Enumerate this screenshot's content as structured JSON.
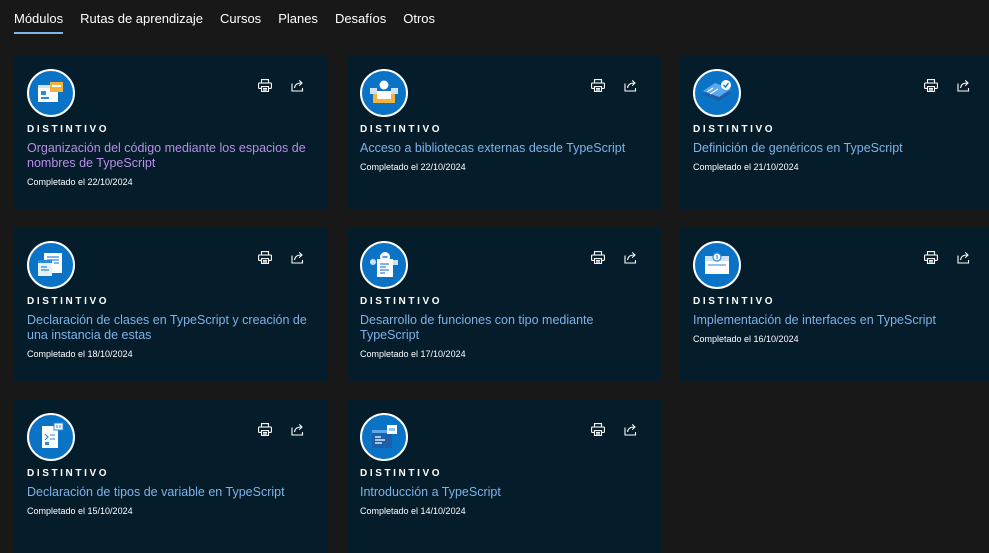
{
  "tabs": [
    {
      "label": "Módulos",
      "active": true
    },
    {
      "label": "Rutas de aprendizaje",
      "active": false
    },
    {
      "label": "Cursos",
      "active": false
    },
    {
      "label": "Planes",
      "active": false
    },
    {
      "label": "Desafíos",
      "active": false
    },
    {
      "label": "Otros",
      "active": false
    }
  ],
  "colors": {
    "accent": "#7fb6ea",
    "link": "#7db3e8",
    "visited_link": "#b78fe6",
    "card_bg": "#051c2a",
    "page_bg": "#181818",
    "badge_bg": "#0a73c6"
  },
  "cards": [
    {
      "kind": "DISTINTIVO",
      "title": "Organización del código mediante los espacios de nombres de TypeScript",
      "date": "Completado el 22/10/2024",
      "visited": true,
      "icon": "namespaces-badge-icon"
    },
    {
      "kind": "DISTINTIVO",
      "title": "Acceso a bibliotecas externas desde TypeScript",
      "date": "Completado el 22/10/2024",
      "visited": false,
      "icon": "external-libraries-badge-icon"
    },
    {
      "kind": "DISTINTIVO",
      "title": "Definición de genéricos en TypeScript",
      "date": "Completado el 21/10/2024",
      "visited": false,
      "icon": "generics-badge-icon"
    },
    {
      "kind": "DISTINTIVO",
      "title": "Declaración de clases en TypeScript y creación de una instancia de estas",
      "date": "Completado el 18/10/2024",
      "visited": false,
      "icon": "classes-badge-icon"
    },
    {
      "kind": "DISTINTIVO",
      "title": "Desarrollo de funciones con tipo mediante TypeScript",
      "date": "Completado el 17/10/2024",
      "visited": false,
      "icon": "functions-badge-icon"
    },
    {
      "kind": "DISTINTIVO",
      "title": "Implementación de interfaces en TypeScript",
      "date": "Completado el 16/10/2024",
      "visited": false,
      "icon": "interfaces-badge-icon"
    },
    {
      "kind": "DISTINTIVO",
      "title": "Declaración de tipos de variable en TypeScript",
      "date": "Completado el 15/10/2024",
      "visited": false,
      "icon": "variable-types-badge-icon"
    },
    {
      "kind": "DISTINTIVO",
      "title": "Introducción a TypeScript",
      "date": "Completado el 14/10/2024",
      "visited": false,
      "icon": "intro-badge-icon"
    }
  ],
  "actions": {
    "print_icon": "print-icon",
    "share_icon": "share-icon"
  }
}
